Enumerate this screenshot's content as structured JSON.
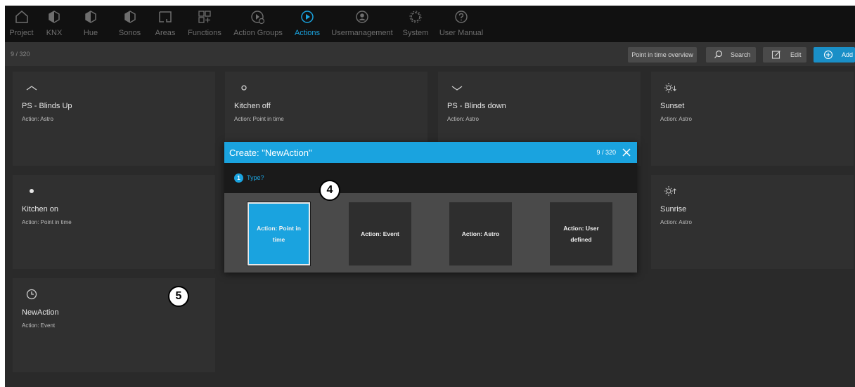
{
  "nav": {
    "items": [
      {
        "label": "Project",
        "icon": "home-icon",
        "active": false
      },
      {
        "label": "KNX",
        "icon": "knx-icon",
        "active": false
      },
      {
        "label": "Hue",
        "icon": "hue-icon",
        "active": false
      },
      {
        "label": "Sonos",
        "icon": "sonos-icon",
        "active": false
      },
      {
        "label": "Areas",
        "icon": "areas-icon",
        "active": false
      },
      {
        "label": "Functions",
        "icon": "functions-icon",
        "active": false
      },
      {
        "label": "Action Groups",
        "icon": "action-groups-icon",
        "active": false
      },
      {
        "label": "Actions",
        "icon": "actions-icon",
        "active": true
      },
      {
        "label": "Usermanagement",
        "icon": "user-icon",
        "active": false
      },
      {
        "label": "System",
        "icon": "system-gear-icon",
        "active": false
      },
      {
        "label": "User Manual",
        "icon": "help-icon",
        "active": false
      }
    ]
  },
  "toolbar": {
    "count": "9 / 320",
    "overview_label": "Point in time overview",
    "search_label": "Search",
    "edit_label": "Edit",
    "add_label": "Add"
  },
  "cards": [
    {
      "name": "PS - Blinds Up",
      "type": "Action: Astro",
      "icon": "chevron-up-icon"
    },
    {
      "name": "Kitchen off",
      "type": "Action: Point in time",
      "icon": "circle-outline-icon"
    },
    {
      "name": "PS - Blinds down",
      "type": "Action: Astro",
      "icon": "chevron-down-icon"
    },
    {
      "name": "Sunset",
      "type": "Action: Astro",
      "icon": "sunset-icon"
    },
    {
      "name": "Kitchen on",
      "type": "Action: Point in time",
      "icon": "dot-icon"
    },
    {
      "name": "Sunrise",
      "type": "Action: Astro",
      "icon": "sunrise-icon"
    },
    {
      "name": "NewAction",
      "type": "Action: Event",
      "icon": "clock-icon"
    }
  ],
  "modal": {
    "title": "Create: \"NewAction\"",
    "count": "9 / 320",
    "step_number": "1",
    "step_label": "Type?",
    "options": [
      {
        "label": "Action: Point in time",
        "selected": true
      },
      {
        "label": "Action: Event",
        "selected": false
      },
      {
        "label": "Action: Astro",
        "selected": false
      },
      {
        "label": "Action: User defined",
        "selected": false
      }
    ]
  },
  "annotations": {
    "badge_a": "4",
    "badge_b": "5"
  },
  "colors": {
    "accent": "#1aa3df",
    "background": "#2a2a2a",
    "card": "#303030",
    "nav": "#111111"
  }
}
